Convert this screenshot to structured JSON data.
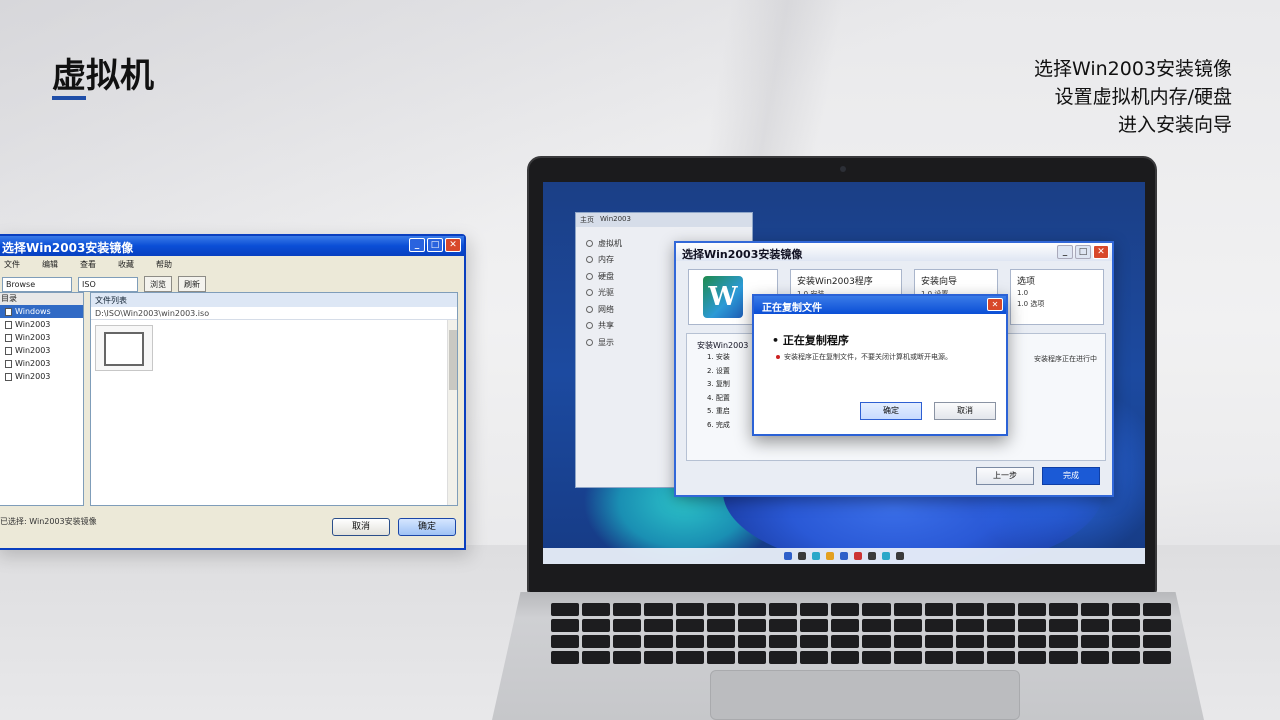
{
  "slide": {
    "title": "虚拟机",
    "steps": [
      "选择Win2003安装镜像",
      "设置虚拟机内存/硬盘",
      "进入安装向导"
    ]
  },
  "left_window": {
    "title": "选择Win2003安装镜像",
    "menu": [
      "文件",
      "编辑",
      "查看",
      "收藏",
      "帮助"
    ],
    "toolbar": {
      "combo1": "Browse",
      "combo2": "ISO",
      "btn1": "浏览",
      "btn2": "刷新"
    },
    "tree": {
      "header": "目录",
      "items": [
        "Windows",
        "Win2003",
        "Win2003",
        "Win2003",
        "Win2003",
        "Win2003"
      ]
    },
    "file_pane": {
      "header": "文件列表",
      "path": "D:\\ISO\\Win2003\\win2003.iso"
    },
    "status": "已选择: Win2003安装镜像",
    "buttons": {
      "cancel": "取消",
      "ok": "确定"
    }
  },
  "laptop": {
    "vm_window": {
      "tabs": [
        "主页",
        "Win2003"
      ],
      "items": [
        "虚拟机",
        "内存",
        "硬盘",
        "光驱",
        "网络",
        "共享",
        "显示"
      ]
    },
    "installer": {
      "title": "选择Win2003安装镜像",
      "logo_letter": "W",
      "box1": {
        "title": "安装Win2003程序",
        "sub": "1.0 安装"
      },
      "box2": {
        "title": "安装向导",
        "sub": "1.0 设置"
      },
      "box3": {
        "title": "选项",
        "sub1": "1.0",
        "sub2": "1.0 选项"
      },
      "list_header": "安装Win2003",
      "rows": [
        "1. 安装",
        "2. 设置",
        "3. 复制",
        "4. 配置",
        "5. 重启",
        "6. 完成"
      ],
      "note": "安装程序正在进行中",
      "buttons": {
        "back": "上一步",
        "ok": "完成"
      }
    },
    "copy_dialog": {
      "title": "正在复制文件",
      "main": "正在复制程序",
      "desc": "安装程序正在复制文件，不要关闭计算机或断开电源。",
      "buttons": {
        "ok": "确定",
        "cancel": "取消"
      }
    }
  }
}
